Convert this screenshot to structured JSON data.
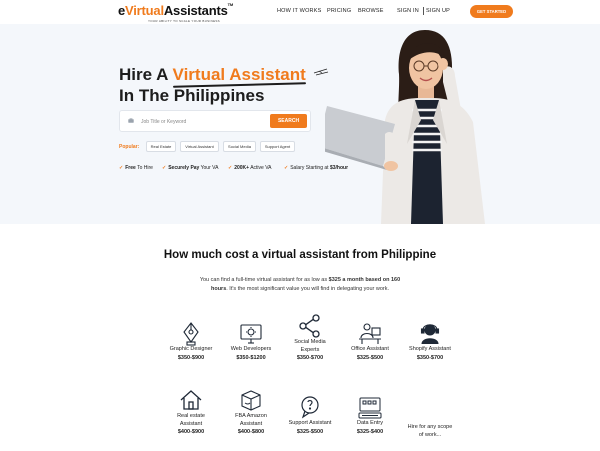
{
  "nav": {
    "logo_e": "e",
    "logo_virtual": "Virtual",
    "logo_assistants": "Assistants",
    "logo_tm": "TM",
    "logo_tagline": "YOUR ABILITY TO SCALE YOUR BUSINESS",
    "links": [
      "HOW IT WORKS",
      "PRICING",
      "BROWSE"
    ],
    "signin": "SIGN IN",
    "signup": "SIGN UP",
    "cta": "GET STARTED"
  },
  "hero": {
    "title_pre": "Hire A ",
    "title_highlight": "Virtual Assistant",
    "title_line2": "In The Philippines",
    "search": {
      "placeholder": "Job Title or Keyword",
      "value": "",
      "button": "SEARCH"
    },
    "popular_label": "Popular:",
    "tags": [
      "Real Estate",
      "Virtual Assistant",
      "Social Media",
      "Support Agent"
    ],
    "features": [
      {
        "bold": "Free",
        "rest": " To Hire"
      },
      {
        "bold": "Securely Pay",
        "rest": " Your VA"
      },
      {
        "bold": "200K+",
        "rest": " Active VA"
      },
      {
        "bold": "",
        "rest": "Salary Starting at ",
        "bold2": "$3/hour"
      }
    ],
    "accent_color": "#f07b1d"
  },
  "section": {
    "title": "How much cost a virtual assistant from Philippine",
    "sub_line1_pre": "You can find a full-time virtual assistant for as low as ",
    "sub_line1_bold": "$325 a month based on 160",
    "sub_line2_bold": "hours",
    "sub_line2_rest": ". It's the most significant value you will find in delegating your work."
  },
  "services": [
    {
      "icon": "graphic-design-icon",
      "name": [
        "Graphic Designer"
      ],
      "price": "$350-$900"
    },
    {
      "icon": "web-developer-icon",
      "name": [
        "Web Developers"
      ],
      "price": "$350-$1200"
    },
    {
      "icon": "share-icon",
      "name": [
        "Social Media",
        "Experts"
      ],
      "price": "$350-$700"
    },
    {
      "icon": "office-assistant-icon",
      "name": [
        "Office Assistant"
      ],
      "price": "$325-$500"
    },
    {
      "icon": "headset-agent-icon",
      "name": [
        "Shopify Assistant"
      ],
      "price": "$350-$700"
    },
    {
      "icon": "house-icon",
      "name": [
        "Real estate",
        "Assistant"
      ],
      "price": "$400-$900"
    },
    {
      "icon": "amazon-box-icon",
      "name": [
        "FBA Amazon",
        "Assistant"
      ],
      "price": "$400-$800"
    },
    {
      "icon": "support-chat-icon",
      "name": [
        "Support Assistant"
      ],
      "price": "$325-$500"
    },
    {
      "icon": "data-entry-icon",
      "name": [
        "Data Entry"
      ],
      "price": "$325-$400"
    },
    {
      "icon": "",
      "name": [
        "Hire for any scope",
        "of work..."
      ],
      "price": ""
    }
  ]
}
